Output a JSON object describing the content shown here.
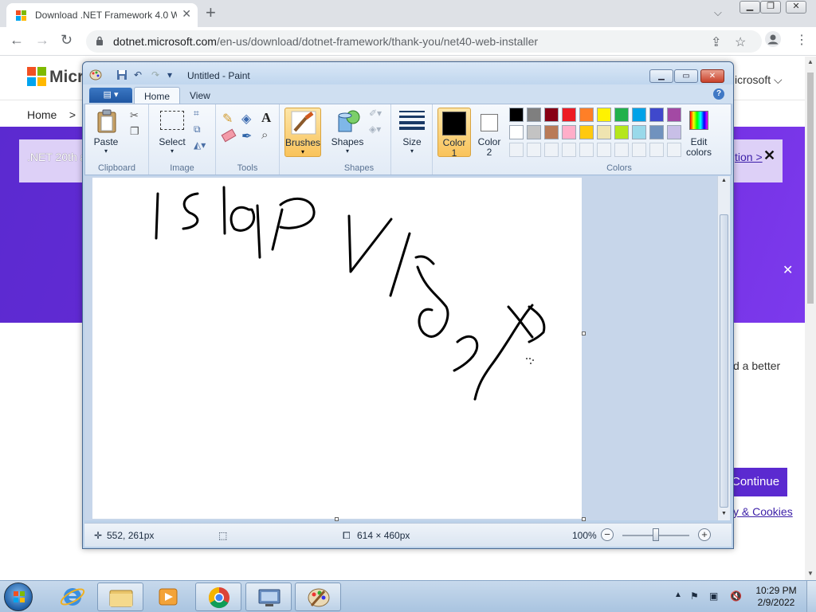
{
  "browser": {
    "tab_title": "Download .NET Framework 4.0 W",
    "tab_close": "✕",
    "new_tab": "+",
    "url_host": "dotnet.microsoft.com",
    "url_path": "/en-us/download/dotnet-framework/thank-you/net40-web-installer"
  },
  "page": {
    "brand": "Micr",
    "nav_right": "icrosoft ⌵",
    "breadcrumb_home": "Home",
    "breadcrumb_sep": ">",
    "banner_text": ".NET 20th a",
    "banner_link": "tion >",
    "banner_close": "✕",
    "banner2_close": "✕",
    "body_text": "d a better",
    "continue_label": "Continue",
    "cookies_link": "y & Cookies"
  },
  "paint": {
    "title": "Untitled - Paint",
    "tab_home": "Home",
    "tab_view": "View",
    "help": "?",
    "groups": {
      "clipboard": "Clipboard",
      "image": "Image",
      "tools": "Tools",
      "shapes": "Shapes",
      "colors": "Colors"
    },
    "buttons": {
      "paste": "Paste",
      "select": "Select",
      "brushes": "Brushes",
      "shapes": "Shapes",
      "size": "Size",
      "color1_a": "Color",
      "color1_b": "1",
      "color2_a": "Color",
      "color2_b": "2",
      "edit_a": "Edit",
      "edit_b": "colors"
    },
    "palette_row1": [
      "#000000",
      "#7f7f7f",
      "#880015",
      "#ed1c24",
      "#ff7f27",
      "#fff200",
      "#22b14c",
      "#00a2e8",
      "#3f48cc",
      "#a349a4"
    ],
    "palette_row2": [
      "#ffffff",
      "#c3c3c3",
      "#b97a57",
      "#ffaec9",
      "#ffc90e",
      "#efe4b0",
      "#b5e61d",
      "#99d9ea",
      "#7092be",
      "#c8bfe7"
    ],
    "status": {
      "cursor": "552, 261px",
      "size": "614 × 460px",
      "zoom": "100%"
    }
  },
  "taskbar": {
    "time": "10:29 PM",
    "date": "2/9/2022"
  }
}
